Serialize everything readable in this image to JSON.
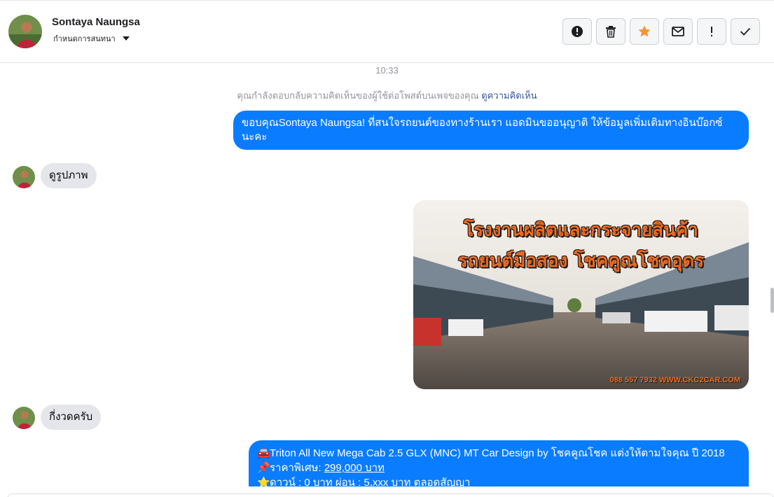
{
  "header": {
    "contact_name": "Sontaya Naungsa",
    "conversation_label": "กำหนดการสนทนา",
    "actions": [
      {
        "name": "report-button",
        "icon": "alert-circle-icon"
      },
      {
        "name": "delete-button",
        "icon": "trash-icon"
      },
      {
        "name": "star-button",
        "icon": "star-icon"
      },
      {
        "name": "mark-unread-button",
        "icon": "envelope-icon"
      },
      {
        "name": "spam-button",
        "icon": "exclamation-icon"
      },
      {
        "name": "mark-done-button",
        "icon": "check-icon"
      }
    ]
  },
  "chat": {
    "timestamp": "10:33",
    "system_note": "คุณกำลังตอบกลับความคิดเห็นของผู้ใช้ต่อโพสต์บนเพจของคุณ",
    "system_note_link": "ดูความคิดเห็น",
    "messages": {
      "out1_line1": "ขอบคุณSontaya Naungsa! ที่สนใจรถยนต์ของทางร้านเรา แอดมินขออนุญาติ ให้ข้อมูลเพิ่มเติมทางอินบ๊อกซ์",
      "out1_line2": "นะคะ",
      "in1": "ดูรูปภาพ",
      "image_heading1": "โรงงานผลิตและกระจายสินค้า",
      "image_heading2": "รถยนต์มือสอง โชคคูณโชคอุดร",
      "image_footer": "088 557 7932 WWW.CKC2CAR.COM",
      "in2": "กี่งวดครับ",
      "car_title": "Triton All New Mega Cab 2.5 GLX (MNC) MT Car Design by โชคคูณโชค แต่งให้ตามใจคุณ ปี 2018",
      "car_price_label": "ราคาพิเศษ:",
      "car_price_value": "299,000 บาท",
      "car_terms": "ดาวน์ : 0 บาท ผ่อน : 5,xxx บาท ตลอดสัญญา"
    }
  },
  "colors": {
    "outgoing_bubble": "#0a7cff",
    "incoming_bubble": "#e4e6eb",
    "star_accent": "#f7923a",
    "link": "#385898"
  }
}
